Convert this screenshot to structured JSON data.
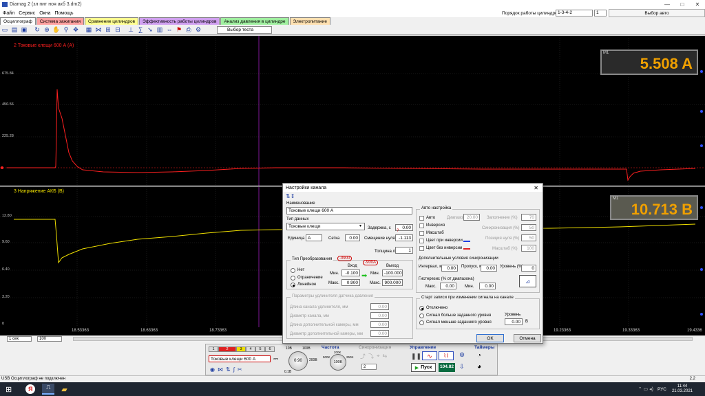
{
  "window": {
    "title": "Diamag 2 (зл пит ноя акб 3.dm2)",
    "min": "—",
    "max": "□",
    "close": "✕"
  },
  "menu": [
    "Файл",
    "Сервис",
    "Окна",
    "Помощь"
  ],
  "cylorder": {
    "label": "Порядок работы цилиндров",
    "value": "1-3-4-2",
    "count": "1",
    "auto_select": "Выбор авто"
  },
  "tabs": [
    {
      "label": "Осциллограф",
      "color": "#ffffff"
    },
    {
      "label": "Система зажигания",
      "color": "#ffa0a0"
    },
    {
      "label": "Сравнение цилиндров",
      "color": "#ffff90"
    },
    {
      "label": "Эффективность работы цилиндров",
      "color": "#d0a0f0"
    },
    {
      "label": "Анализ давления в цилиндре",
      "color": "#a0f0a0"
    },
    {
      "label": "Электропитание",
      "color": "#ffe0b0"
    }
  ],
  "toolbar": {
    "test_select": "Выбор теста"
  },
  "channel1": {
    "label": "2 Токовые клещи 600 А (А)",
    "ticks": [
      "675.84",
      "450.56",
      "225.28",
      "0"
    ],
    "meas_tag": "M1",
    "meas_value": "5.508 A",
    "color": "#ff2020"
  },
  "channel2": {
    "label": "3 Напряжение АКБ (В)",
    "ticks": [
      "12.80",
      "9.60",
      "6.40",
      "3.20",
      "0"
    ],
    "meas_tag": "M1",
    "meas_value": "10.713 B",
    "color": "#f0e000"
  },
  "timeaxis": [
    "18.53363",
    "18.63363",
    "18.73363",
    "19.23363",
    "19.33363",
    "19.4336"
  ],
  "zoom": {
    "sweep": "1 сек",
    "scale": "100"
  },
  "dialog": {
    "title": "Настройки канала",
    "close": "✕",
    "name_label": "Наименование",
    "name_value": "Токовые клещи 600 А",
    "datatype_label": "Тип данных",
    "datatype_value": "Токовые клещи",
    "unit_label": "Единица",
    "unit_value": "A",
    "grid_label": "Сетка",
    "grid_value": "0.00",
    "delay_label": "Задержка, с",
    "delay_value": "0.00",
    "zero_label": "Смещение нуля",
    "zero_value": "-1.113",
    "linewidth_label": "Толщина линии",
    "linewidth_value": "1",
    "conv_group": "Тип Преобразования",
    "conv_none": "Нет",
    "conv_limit": "Ограничение",
    "conv_linear": "Линейное",
    "input_label": "Вход",
    "output_label": "Выход",
    "min_label": "Мин.",
    "max_label": "Макс.",
    "in_min": "-0.100",
    "in_max": "0.900",
    "out_min": "-100.000",
    "out_max": "900.000",
    "anno1": "-0900",
    "anno2": "-900A",
    "anno3": "?",
    "ext_group": "Параметры удлинителя датчика давления",
    "ext_rows": [
      {
        "label": "Длина канала удлинителя, мм",
        "value": "0.00"
      },
      {
        "label": "Диаметр канала, мм",
        "value": "0.00"
      },
      {
        "label": "Длина дополнительной камеры, мм",
        "value": "0.00"
      },
      {
        "label": "Диаметр дополнительной камеры, мм",
        "value": "0.00"
      }
    ],
    "auto_group": "Авто настройка",
    "auto_items": [
      "Авто",
      "Инверсия",
      "Масштаб",
      "Цвет при инверсии",
      "Цвет без инверсии"
    ],
    "auto_params": [
      {
        "label": "Диапазон",
        "value": "20.00"
      },
      {
        "label": "Заполнение (%)",
        "value": "70"
      },
      {
        "label": "Синхронизация (%)",
        "value": "50"
      },
      {
        "label": "Позиция нуля (%)",
        "value": "50"
      },
      {
        "label": "Масштаб (%)",
        "value": "100"
      }
    ],
    "sync_title": "Дополнительные условия синхронизации",
    "sync_interval": "Интервал, мс",
    "sync_interval_v": "0.00",
    "sync_skip": "Пропуск, мс",
    "sync_skip_v": "0.00",
    "sync_level": "Уровень (%)",
    "sync_level_v": "0",
    "hyst_label": "Гистерезис (% от диапазона)",
    "hyst_max": "Макс.",
    "hyst_max_v": "0.00",
    "hyst_min": "Мин.",
    "hyst_min_v": "0.00",
    "start_group": "Старт записи при изменении сигнала на канале",
    "start_off": "Отключено",
    "start_above": "Сигнал больше заданного уровня",
    "start_below": "Сигнал меньше заданного уровня",
    "level_label": "Уровень",
    "level_value": "0.00",
    "level_unit": "В",
    "ok": "OK",
    "cancel": "Отмена"
  },
  "bottom": {
    "channel_name": "Токовые клещи 600 А",
    "knob1": "0.90",
    "knob1_lo": "0.1В",
    "knob1_hi": "200В",
    "knob1_top": "10В",
    "knob1_top2": "100В",
    "freq_title": "Частота",
    "freq_value": "100K",
    "freq_marks": [
      "100K",
      "200K",
      "250K",
      "500K"
    ],
    "sync_title": "Синхронизация",
    "sync_value": "2",
    "control_title": "Управление",
    "start": "Пуск",
    "rate": "104.82",
    "timers_title": "Таймеры",
    "ch_buttons": [
      "1",
      "2",
      "3",
      "4",
      "5",
      "6"
    ]
  },
  "status": {
    "left": "USB Осциллограф не подключен",
    "right": "2.2"
  },
  "taskbar": {
    "lang": "РУС",
    "time": "11:44",
    "date": "21.03.2021"
  }
}
